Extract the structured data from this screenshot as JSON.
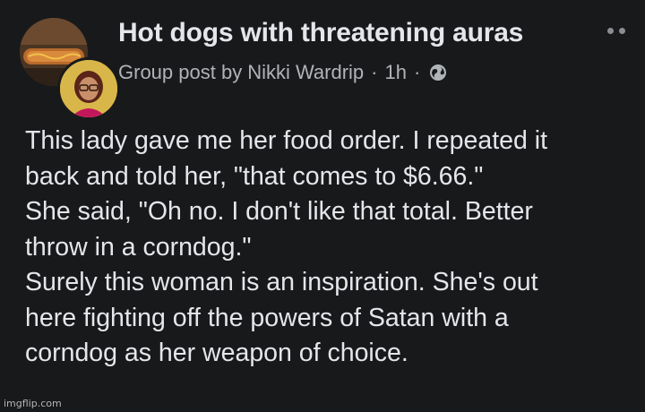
{
  "header": {
    "group_name": "Hot dogs with threatening auras",
    "post_prefix": "Group post by",
    "author": "Nikki Wardrip",
    "separator": "·",
    "time": "1h",
    "privacy_icon": "globe-icon",
    "more_icon": "more-options-icon"
  },
  "post": {
    "lines": [
      "This lady gave me her food order. I repeated it",
      "back and told her, \"that comes to $6.66.\"",
      "She said, \"Oh no. I don't like that total. Better",
      "throw in a corndog.\"",
      "Surely this woman is an inspiration. She's out",
      "here fighting off the powers of Satan with a",
      "corndog as her weapon of choice."
    ]
  },
  "watermark": "imgflip.com",
  "colors": {
    "background": "#18191a",
    "primary_text": "#e4e6eb",
    "secondary_text": "#b0b3b8"
  }
}
